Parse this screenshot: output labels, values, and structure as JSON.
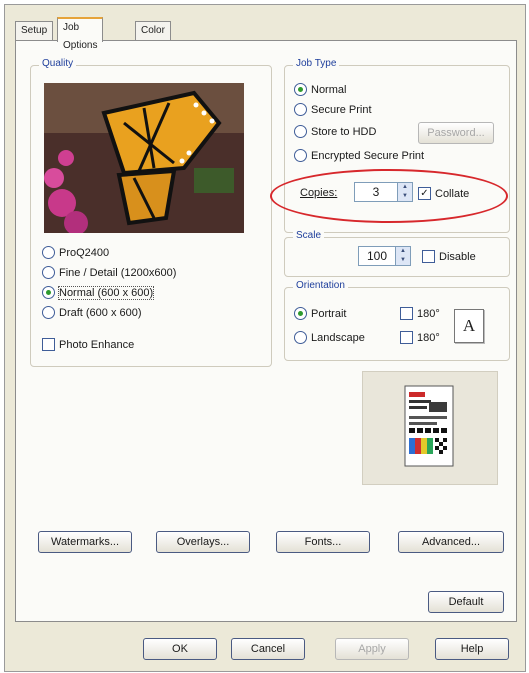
{
  "tabs": [
    {
      "label": "Setup",
      "active": false
    },
    {
      "label": "Job Options",
      "active": true
    },
    {
      "label": "Color",
      "active": false
    }
  ],
  "quality": {
    "legend": "Quality",
    "options": [
      {
        "label": "ProQ2400",
        "selected": false
      },
      {
        "label": "Fine / Detail (1200x600)",
        "selected": false
      },
      {
        "label": "Normal (600 x 600)",
        "selected": true
      },
      {
        "label": "Draft (600 x 600)",
        "selected": false
      }
    ],
    "photo_enhance": {
      "label": "Photo Enhance",
      "checked": false
    }
  },
  "job_type": {
    "legend": "Job Type",
    "options": [
      {
        "label": "Normal",
        "selected": true
      },
      {
        "label": "Secure Print",
        "selected": false
      },
      {
        "label": "Store to HDD",
        "selected": false
      },
      {
        "label": "Encrypted Secure Print",
        "selected": false
      }
    ],
    "password_button": "Password..."
  },
  "copies": {
    "label": "Copies:",
    "value": "3",
    "collate_label": "Collate",
    "collate_checked": true
  },
  "scale": {
    "legend": "Scale",
    "value": "100",
    "disable_label": "Disable",
    "disable_checked": false
  },
  "orientation": {
    "legend": "Orientation",
    "portrait_label": "Portrait",
    "landscape_label": "Landscape",
    "portrait_selected": true,
    "rotate_label_1": "180°",
    "rotate_label_2": "180°",
    "icon_letter": "A"
  },
  "buttons": {
    "watermarks": "Watermarks...",
    "overlays": "Overlays...",
    "fonts": "Fonts...",
    "advanced": "Advanced...",
    "default": "Default"
  },
  "footer": {
    "ok": "OK",
    "cancel": "Cancel",
    "apply": "Apply",
    "help": "Help"
  },
  "colors": {
    "tab_accent": "#e6a33a",
    "legend_blue": "#1f3f9c",
    "highlight_red": "#d7282c",
    "radio_green": "#2e9a2e"
  }
}
